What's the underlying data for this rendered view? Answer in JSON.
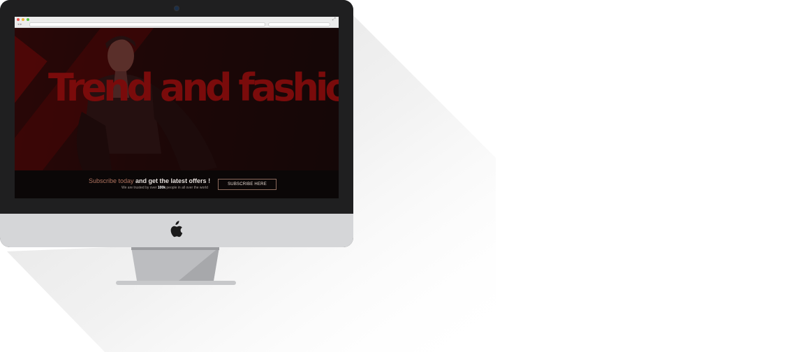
{
  "hero": {
    "title": "Trend and fashion"
  },
  "subscribe": {
    "headline_accent": "Subscribe today",
    "headline_rest": " and get the latest offers !",
    "sub_before": "We are trusted by over ",
    "sub_bold": "100k",
    "sub_after": " people in all over the world",
    "button_label": "SUBSCRIBE HERE"
  },
  "colors": {
    "background": "#ffffff",
    "bezel": "#1f1f20",
    "chin": "#d5d6d8",
    "hero_title": "#7a0b0b",
    "accent": "#b0735f"
  },
  "icons": {
    "camera": "camera-icon",
    "apple": "apple-logo-icon",
    "window_controls": [
      "close-icon",
      "minimize-icon",
      "zoom-icon"
    ],
    "expand": "expand-icon"
  }
}
